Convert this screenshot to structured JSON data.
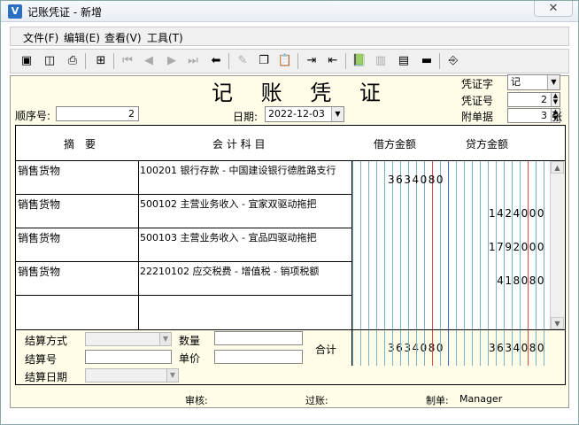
{
  "window": {
    "title": "记账凭证 - 新增",
    "close_glyph": "✕"
  },
  "menu": [
    {
      "label": "文件(F)"
    },
    {
      "label": "编辑(E)"
    },
    {
      "label": "查看(V)"
    },
    {
      "label": "工具(T)"
    }
  ],
  "voucher": {
    "title": "记 账 凭 证",
    "seq_label": "顺序号:",
    "seq_value": "2",
    "date_label": "日期:",
    "date_value": "2022-12-03",
    "type_label": "凭证字",
    "type_value": "记",
    "no_label": "凭证号",
    "no_value": "2",
    "attach_label": "附单据",
    "attach_value": "3",
    "attach_unit": "张"
  },
  "grid": {
    "headers": {
      "summary": "摘　要",
      "account": "会 计 科 目",
      "debit": "借方金额",
      "credit": "贷方金额"
    },
    "rows": [
      {
        "summary": "销售货物",
        "account": "100201 银行存款 - 中国建设银行德胜路支行",
        "debit": "3634080",
        "credit": ""
      },
      {
        "summary": "销售货物",
        "account": "500102 主营业务收入 - 宜家双驱动拖把",
        "debit": "",
        "credit": "1424000"
      },
      {
        "summary": "销售货物",
        "account": "500103 主营业务收入 - 宜品四驱动拖把",
        "debit": "",
        "credit": "1792000"
      },
      {
        "summary": "销售货物",
        "account": "22210102 应交税费 - 增值税 - 销项税额",
        "debit": "",
        "credit": "418080"
      },
      {
        "summary": "",
        "account": "",
        "debit": "",
        "credit": ""
      }
    ]
  },
  "bottom": {
    "settle_method_label": "结算方式",
    "settle_no_label": "结算号",
    "settle_date_label": "结算日期",
    "qty_label": "数量",
    "price_label": "单价",
    "total_label": "合计",
    "total_debit": "3634080",
    "total_credit": "3634080"
  },
  "footer": {
    "audit_label": "审核:",
    "post_label": "过账:",
    "maker_label": "制单:",
    "maker_value": "Manager"
  },
  "colors": {
    "content_bg": "#fffde8",
    "grid_line_blue": "#7ab3c8",
    "grid_line_red": "#e04848"
  }
}
